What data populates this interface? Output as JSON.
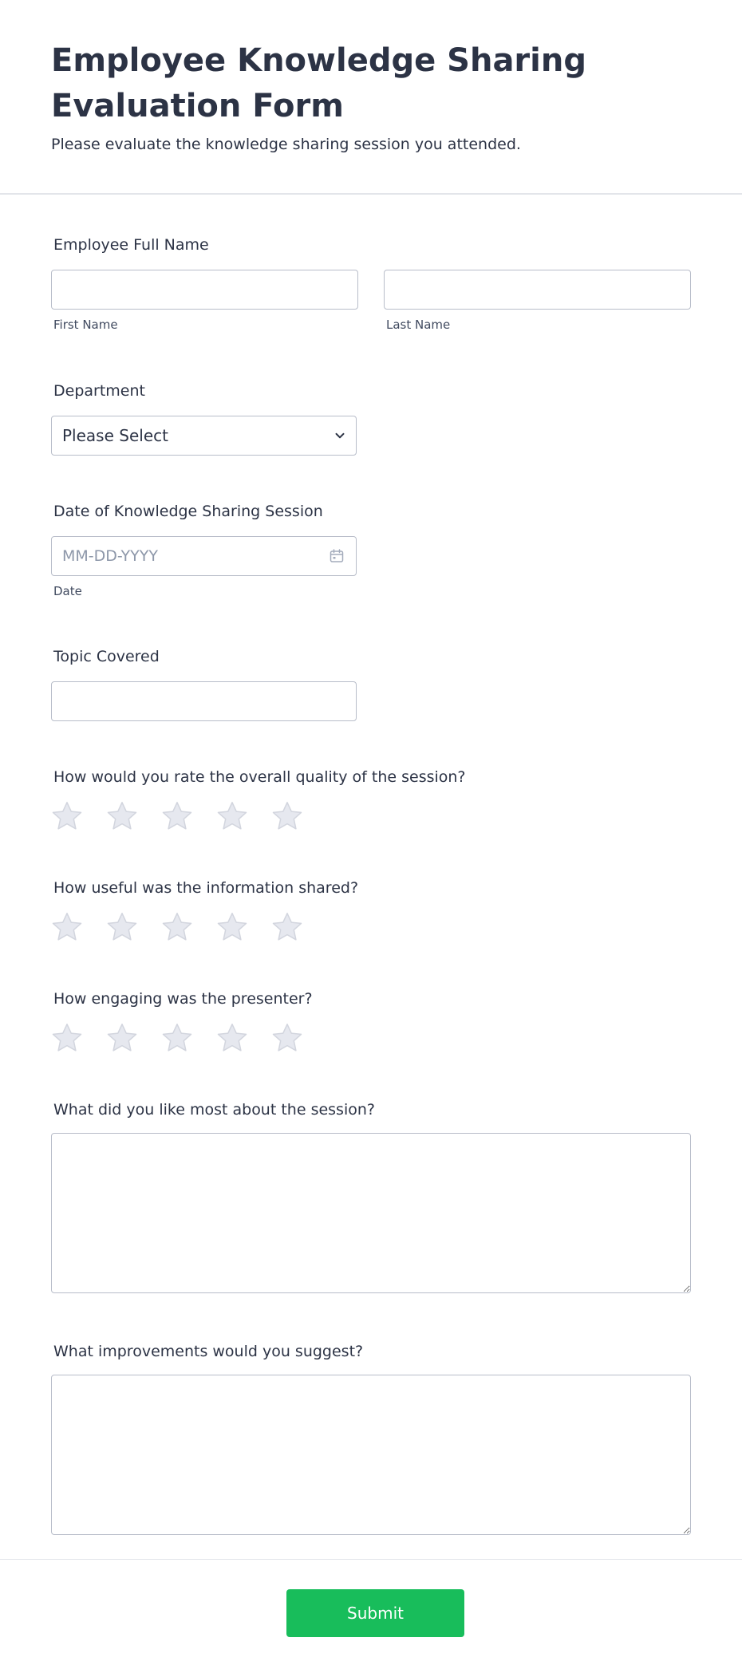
{
  "form": {
    "title": "Employee Knowledge Sharing Evaluation Form",
    "subtitle": "Please evaluate the knowledge sharing session you attended."
  },
  "fields": {
    "full_name": {
      "label": "Employee Full Name",
      "first_sublabel": "First Name",
      "last_sublabel": "Last Name",
      "first_value": "",
      "last_value": ""
    },
    "department": {
      "label": "Department",
      "selected": "Please Select"
    },
    "session_date": {
      "label": "Date of Knowledge Sharing Session",
      "placeholder": "MM-DD-YYYY",
      "sublabel": "Date",
      "value": ""
    },
    "topic": {
      "label": "Topic Covered",
      "value": ""
    },
    "rating_quality": {
      "label": "How would you rate the overall quality of the session?",
      "max_stars": 5,
      "value": 0
    },
    "rating_usefulness": {
      "label": "How useful was the information shared?",
      "max_stars": 5,
      "value": 0
    },
    "rating_presenter": {
      "label": "How engaging was the presenter?",
      "max_stars": 5,
      "value": 0
    },
    "liked_most": {
      "label": "What did you like most about the session?",
      "value": ""
    },
    "improvements": {
      "label": "What improvements would you suggest?",
      "value": ""
    }
  },
  "submit": {
    "label": "Submit"
  },
  "colors": {
    "text": "#2c3345",
    "border": "#b8bdc9",
    "star_fill": "#e6e8ef",
    "star_stroke": "#d2d5de",
    "submit": "#18bd5b"
  },
  "icons": {
    "select": "chevron-down-icon",
    "date": "calendar-icon",
    "rating": "star-icon"
  }
}
